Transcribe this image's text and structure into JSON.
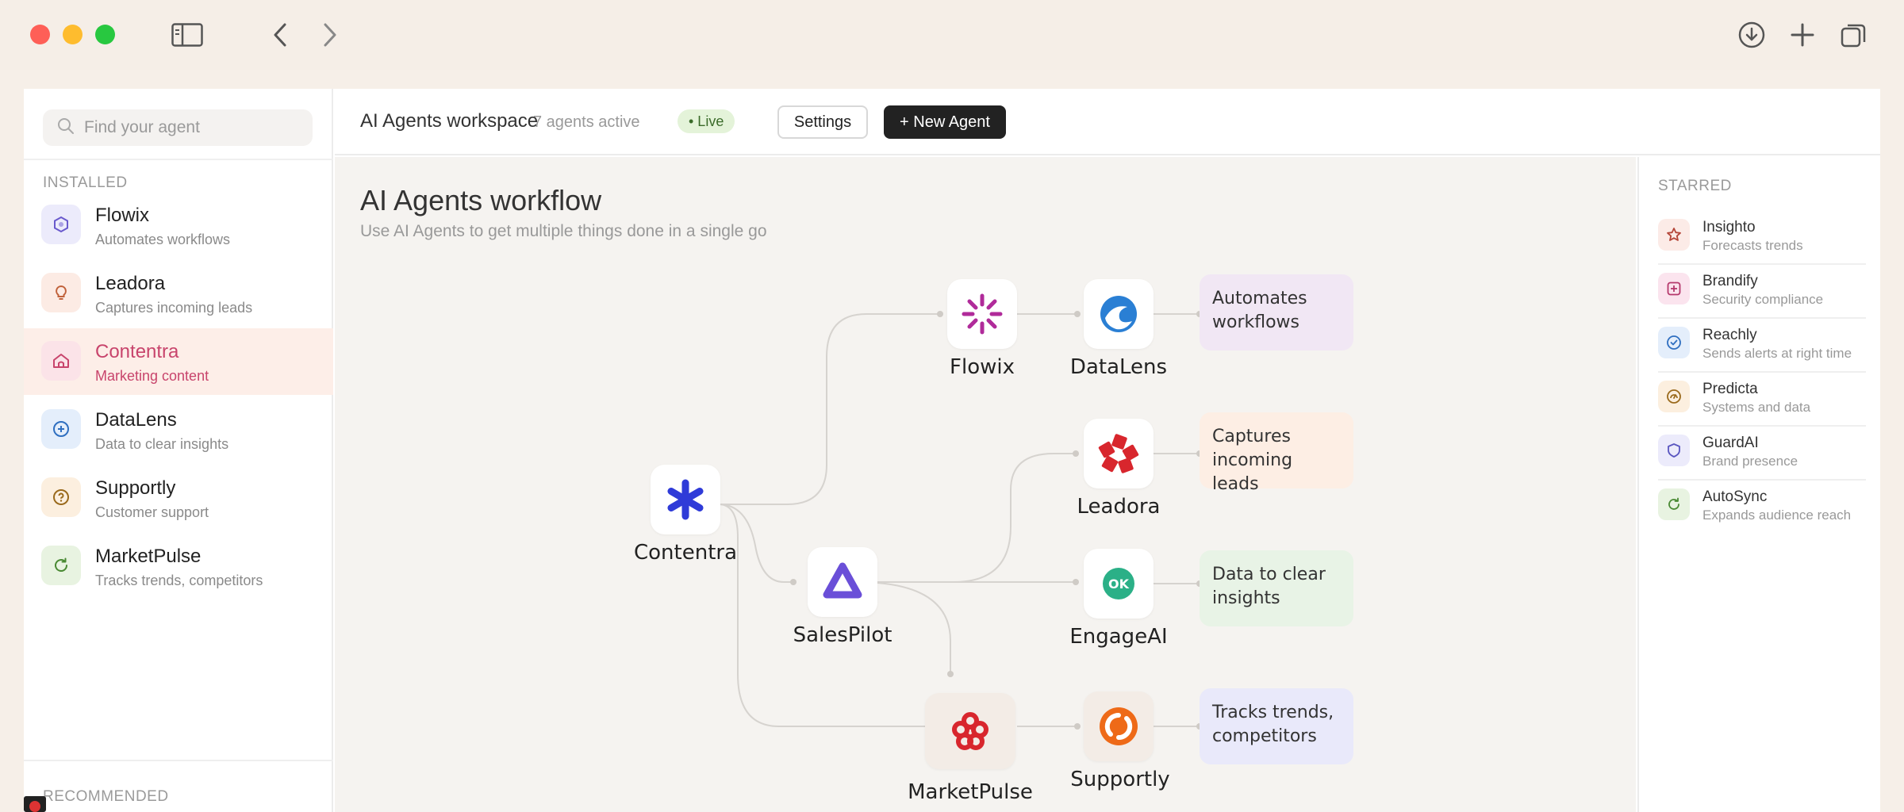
{
  "sidebar": {
    "search_placeholder": "Find your agent",
    "installed_label": "INSTALLED",
    "recommended_label": "RECOMMENDED",
    "items": [
      {
        "name": "Flowix",
        "desc": "Automates workflows",
        "icon": "hexagon-icon",
        "tint": "#ecebfb",
        "color": "#6a5acd"
      },
      {
        "name": "Leadora",
        "desc": "Captures incoming leads",
        "icon": "lightbulb-icon",
        "tint": "#fcebe4",
        "color": "#c0613a"
      },
      {
        "name": "Contentra",
        "desc": "Marketing content",
        "icon": "home-icon",
        "tint": "#fbe3e8",
        "color": "#c8446c",
        "active": true
      },
      {
        "name": "DataLens",
        "desc": "Data to clear insights",
        "icon": "plus-circle-icon",
        "tint": "#e4eefb",
        "color": "#2f6fc0"
      },
      {
        "name": "Supportly",
        "desc": "Customer support",
        "icon": "help-circle-icon",
        "tint": "#fcefdf",
        "color": "#9a6a1c"
      },
      {
        "name": "MarketPulse",
        "desc": "Tracks trends, competitors",
        "icon": "refresh-icon",
        "tint": "#e8f3e1",
        "color": "#4a8a34"
      }
    ]
  },
  "header": {
    "title": "AI Agents workspace",
    "count": "7 agents active",
    "live": "• Live",
    "settings": "Settings",
    "new_agent": "+ New Agent"
  },
  "canvas": {
    "title": "AI Agents workflow",
    "subtitle": "Use AI Agents to get multiple things done in a single go",
    "nodes": {
      "contentra": "Contentra",
      "flowix": "Flowix",
      "datalens": "DataLens",
      "leadora": "Leadora",
      "salespilot": "SalesPilot",
      "engageai": "EngageAI",
      "marketpulse": "MarketPulse",
      "supportly": "Supportly"
    },
    "outputs": [
      {
        "text": "Automates workflows",
        "color": "#f1e7f4"
      },
      {
        "text": "Captures incoming leads",
        "color": "#fdeee4"
      },
      {
        "text": "Data to clear insights",
        "color": "#e8f3e6"
      },
      {
        "text": "Tracks trends, competitors",
        "color": "#e9e9fa"
      }
    ]
  },
  "starred": {
    "label": "STARRED",
    "items": [
      {
        "name": "Insighto",
        "desc": "Forecasts trends",
        "icon": "star-icon",
        "tint": "#fcebe7",
        "color": "#b5473a"
      },
      {
        "name": "Brandify",
        "desc": "Security compliance",
        "icon": "plus-square-icon",
        "tint": "#fbe4ee",
        "color": "#b5386c"
      },
      {
        "name": "Reachly",
        "desc": "Sends alerts at right time",
        "icon": "check-circle-icon",
        "tint": "#e4eefb",
        "color": "#2f6fc0"
      },
      {
        "name": "Predicta",
        "desc": "Systems and data",
        "icon": "gauge-icon",
        "tint": "#fcefdf",
        "color": "#9a6a1c"
      },
      {
        "name": "GuardAI",
        "desc": "Brand presence",
        "icon": "shield-icon",
        "tint": "#ecebfb",
        "color": "#5a56c0"
      },
      {
        "name": "AutoSync",
        "desc": "Expands audience reach",
        "icon": "sync-icon",
        "tint": "#e8f3e1",
        "color": "#4a8a34"
      }
    ]
  }
}
